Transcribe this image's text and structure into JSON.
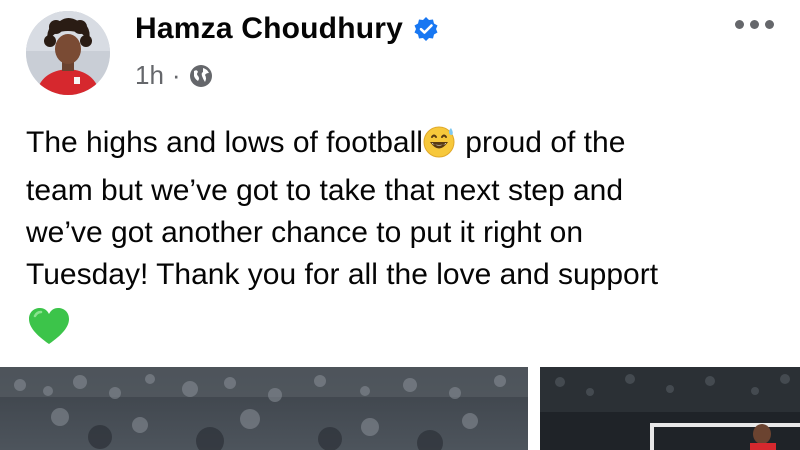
{
  "post": {
    "author": {
      "name": "Hamza Choudhury",
      "verified_icon": "verified-badge-icon"
    },
    "meta": {
      "time": "1h",
      "separator": "·",
      "audience_icon": "globe-icon"
    },
    "more_icon": "more-options-icon",
    "text": {
      "part1": "The highs and lows of football",
      "part2": " proud of the\nteam but we’ve got to take that next step and\nwe’ve got another chance to put it right on\nTuesday! Thank you for all the love and support",
      "emoji_1": "grinning-sweat-icon",
      "emoji_2": "green-heart-icon"
    },
    "colors": {
      "verified_blue": "#1877f2",
      "meta_gray": "#65676b",
      "heart_green": "#3cc44a"
    }
  }
}
